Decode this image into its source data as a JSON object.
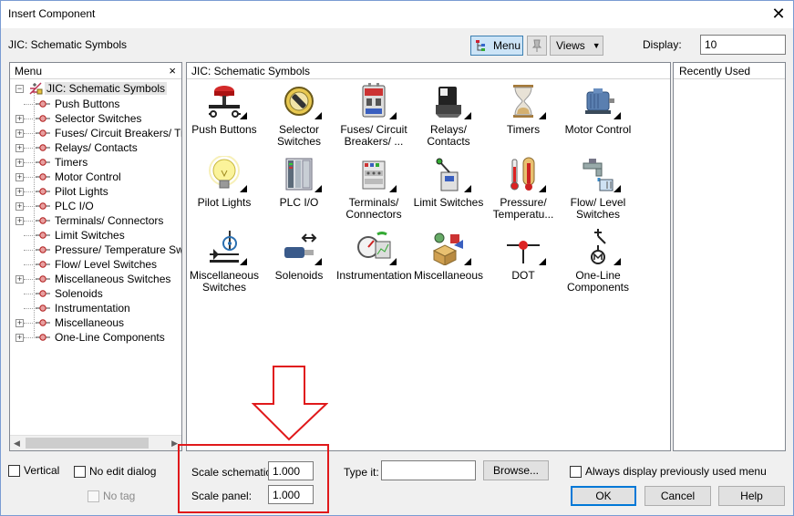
{
  "window": {
    "title": "Insert Component"
  },
  "toolbar": {
    "library_label": "JIC: Schematic Symbols",
    "menu_button": "Menu",
    "views_button": "Views",
    "display_label": "Display:",
    "display_value": "10"
  },
  "menu_panel": {
    "title": "Menu",
    "close": "×",
    "root": "JIC: Schematic Symbols",
    "items": [
      {
        "label": "Push Buttons",
        "expandable": false
      },
      {
        "label": "Selector Switches",
        "expandable": true
      },
      {
        "label": "Fuses/ Circuit Breakers/ Tr",
        "expandable": true
      },
      {
        "label": "Relays/ Contacts",
        "expandable": true
      },
      {
        "label": "Timers",
        "expandable": true
      },
      {
        "label": "Motor Control",
        "expandable": true
      },
      {
        "label": "Pilot Lights",
        "expandable": true
      },
      {
        "label": "PLC I/O",
        "expandable": true
      },
      {
        "label": "Terminals/ Connectors",
        "expandable": true
      },
      {
        "label": "Limit Switches",
        "expandable": false
      },
      {
        "label": "Pressure/ Temperature Sw",
        "expandable": false
      },
      {
        "label": "Flow/ Level Switches",
        "expandable": false
      },
      {
        "label": "Miscellaneous Switches",
        "expandable": true
      },
      {
        "label": "Solenoids",
        "expandable": false
      },
      {
        "label": "Instrumentation",
        "expandable": false
      },
      {
        "label": "Miscellaneous",
        "expandable": true
      },
      {
        "label": "One-Line Components",
        "expandable": true
      }
    ]
  },
  "symbols_panel": {
    "title": "JIC: Schematic Symbols",
    "items": [
      {
        "l1": "Push Buttons",
        "l2": "",
        "icon": "push-button-icon"
      },
      {
        "l1": "Selector",
        "l2": "Switches",
        "icon": "selector-switch-icon"
      },
      {
        "l1": "Fuses/ Circuit",
        "l2": "Breakers/ ...",
        "icon": "fuse-icon"
      },
      {
        "l1": "Relays/",
        "l2": "Contacts",
        "icon": "relay-icon"
      },
      {
        "l1": "Timers",
        "l2": "",
        "icon": "hourglass-icon"
      },
      {
        "l1": "Motor Control",
        "l2": "",
        "icon": "motor-icon"
      },
      {
        "l1": "Pilot Lights",
        "l2": "",
        "icon": "light-bulb-icon"
      },
      {
        "l1": "PLC I/O",
        "l2": "",
        "icon": "plc-icon"
      },
      {
        "l1": "Terminals/",
        "l2": "Connectors",
        "icon": "terminal-icon"
      },
      {
        "l1": "Limit Switches",
        "l2": "",
        "icon": "limit-switch-icon"
      },
      {
        "l1": "Pressure/",
        "l2": "Temperatu...",
        "icon": "thermometer-icon"
      },
      {
        "l1": "Flow/ Level",
        "l2": "Switches",
        "icon": "faucet-icon"
      },
      {
        "l1": "Miscellaneous",
        "l2": "Switches",
        "icon": "misc-switch-icon"
      },
      {
        "l1": "Solenoids",
        "l2": "",
        "icon": "solenoid-icon"
      },
      {
        "l1": "Instrumentation",
        "l2": "",
        "icon": "gauge-icon"
      },
      {
        "l1": "Miscellaneous",
        "l2": "",
        "icon": "boxes-icon"
      },
      {
        "l1": "DOT",
        "l2": "",
        "icon": "dot-icon"
      },
      {
        "l1": "One-Line",
        "l2": "Components",
        "icon": "one-line-icon"
      }
    ]
  },
  "recent_panel": {
    "title": "Recently Used"
  },
  "options": {
    "vertical": "Vertical",
    "no_edit_dialog": "No edit dialog",
    "no_tag": "No tag",
    "scale_schematic_label": "Scale schematic:",
    "scale_schematic_value": "1.000",
    "scale_panel_label": "Scale panel:",
    "scale_panel_value": "1.000",
    "type_it_label": "Type it:",
    "type_it_value": "",
    "browse": "Browse...",
    "always_display": "Always display previously used menu"
  },
  "buttons": {
    "ok": "OK",
    "cancel": "Cancel",
    "help": "Help"
  },
  "colors": {
    "annotation": "#e0191b",
    "accent": "#0078d7"
  }
}
